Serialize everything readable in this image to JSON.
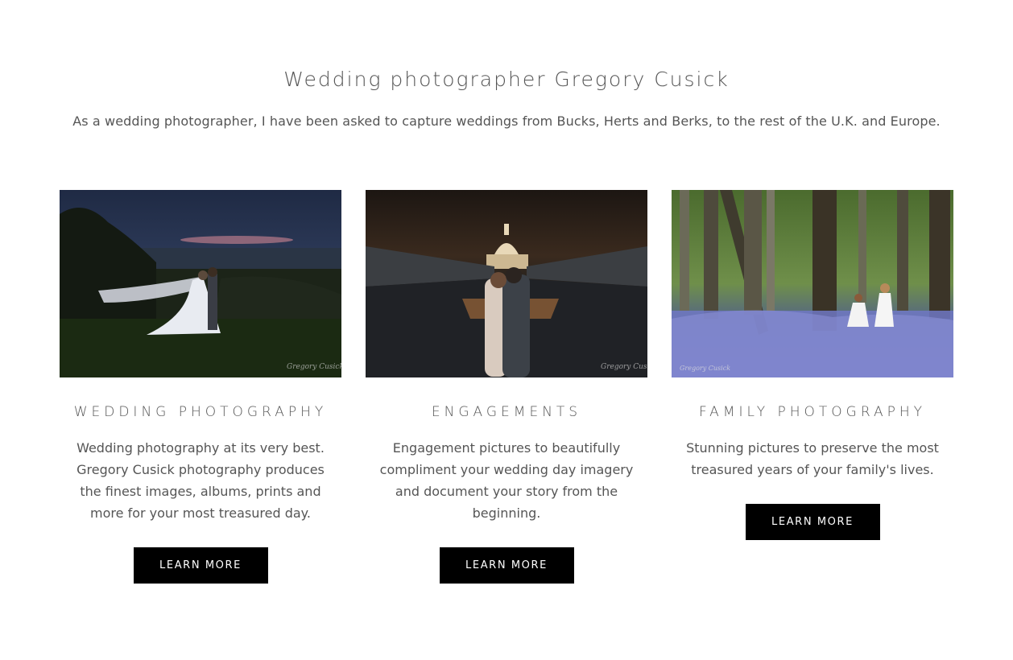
{
  "header": {
    "title": "Wedding photographer Gregory Cusick",
    "subtitle": "As a wedding photographer, I have been asked to capture weddings from Bucks, Herts and Berks, to the rest of the U.K. and Europe."
  },
  "cards": [
    {
      "heading": "WEDDING PHOTOGRAPHY",
      "text": "Wedding photography at its very best. Gregory Cusick photography produces the finest images, albums, prints and more for your most treasured day.",
      "button_label": "LEARN MORE"
    },
    {
      "heading": "ENGAGEMENTS",
      "text": "Engagement pictures to beautifully compliment your wedding day imagery and document your story from the beginning.",
      "button_label": "LEARN MORE"
    },
    {
      "heading": "FAMILY PHOTOGRAPHY",
      "text": "Stunning pictures to preserve the most treasured years of your family's lives.",
      "button_label": "LEARN MORE"
    }
  ],
  "colors": {
    "text": "#555555",
    "button_bg": "#000000",
    "button_text": "#ffffff",
    "background": "#ffffff"
  }
}
